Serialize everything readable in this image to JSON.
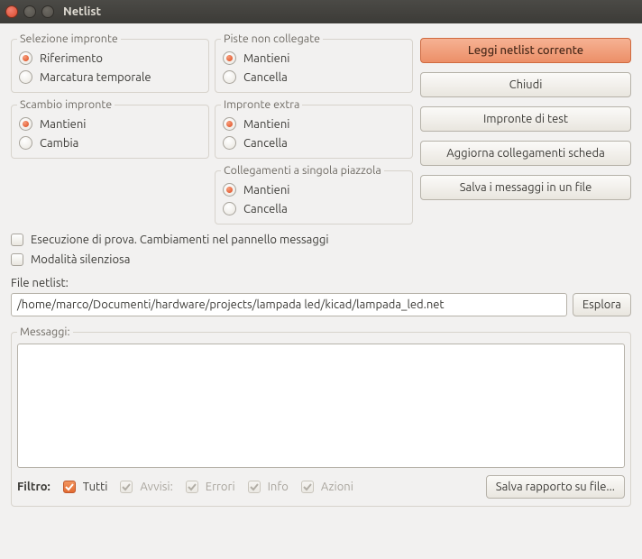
{
  "window": {
    "title": "Netlist"
  },
  "groups": {
    "selezione": {
      "legend": "Selezione impronte",
      "opt1": "Riferimento",
      "opt2": "Marcatura temporale"
    },
    "scambio": {
      "legend": "Scambio impronte",
      "opt1": "Mantieni",
      "opt2": "Cambia"
    },
    "piste": {
      "legend": "Piste non collegate",
      "opt1": "Mantieni",
      "opt2": "Cancella"
    },
    "extra": {
      "legend": "Impronte extra",
      "opt1": "Mantieni",
      "opt2": "Cancella"
    },
    "singola": {
      "legend": "Collegamenti a singola piazzola",
      "opt1": "Mantieni",
      "opt2": "Cancella"
    }
  },
  "buttons": {
    "leggi": "Leggi netlist corrente",
    "chiudi": "Chiudi",
    "test": "Impronte di test",
    "aggiorna": "Aggiorna collegamenti scheda",
    "salva": "Salva i messaggi in un file",
    "esplora": "Esplora",
    "salva_rapporto": "Salva rapporto su file..."
  },
  "checks": {
    "esecuzione": "Esecuzione di prova. Cambiamenti nel pannello messaggi",
    "silenziosa": "Modalità silenziosa"
  },
  "file": {
    "label": "File netlist:",
    "value": "/home/marco/Documenti/hardware/projects/lampada led/kicad/lampada_led.net"
  },
  "messages": {
    "legend": "Messaggi:"
  },
  "filter": {
    "label": "Filtro:",
    "tutti": "Tutti",
    "avvisi": "Avvisi:",
    "errori": "Errori",
    "info": "Info",
    "azioni": "Azioni"
  }
}
